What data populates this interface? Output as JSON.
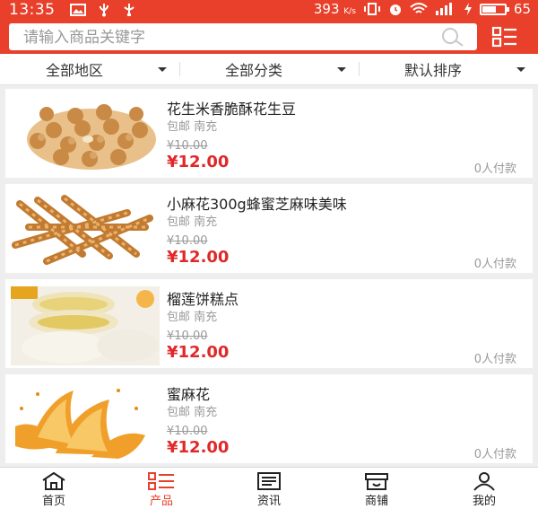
{
  "status_bar": {
    "time": "13:35",
    "speed": "393",
    "speed_unit": "K/s",
    "battery": "65",
    "battery_level": 0.65
  },
  "search": {
    "placeholder": "请输入商品关键字",
    "value": ""
  },
  "filters": [
    {
      "label": "全部地区"
    },
    {
      "label": "全部分类"
    },
    {
      "label": "默认排序"
    }
  ],
  "products": [
    {
      "title": "花生米香脆酥花生豆",
      "tags": "包邮 南充",
      "old_price": "¥10.00",
      "price": "¥12.00",
      "sales": "0人付款"
    },
    {
      "title": "小麻花300g蜂蜜芝麻味美味",
      "tags": "包邮 南充",
      "old_price": "¥10.00",
      "price": "¥12.00",
      "sales": "0人付款"
    },
    {
      "title": "榴莲饼糕点",
      "tags": "包邮 南充",
      "old_price": "¥10.00",
      "price": "¥12.00",
      "sales": "0人付款"
    },
    {
      "title": "蜜麻花",
      "tags": "包邮 南充",
      "old_price": "¥10.00",
      "price": "¥12.00",
      "sales": "0人付款"
    }
  ],
  "tabs": [
    {
      "label": "首页",
      "icon": "home-icon"
    },
    {
      "label": "产品",
      "icon": "list-icon"
    },
    {
      "label": "资讯",
      "icon": "news-icon"
    },
    {
      "label": "商铺",
      "icon": "shop-icon"
    },
    {
      "label": "我的",
      "icon": "user-icon"
    }
  ],
  "active_tab": "产品",
  "colors": {
    "brand": "#e8402a",
    "price": "#e0282a",
    "muted": "#9a9a9a",
    "background": "#eeeeee"
  }
}
